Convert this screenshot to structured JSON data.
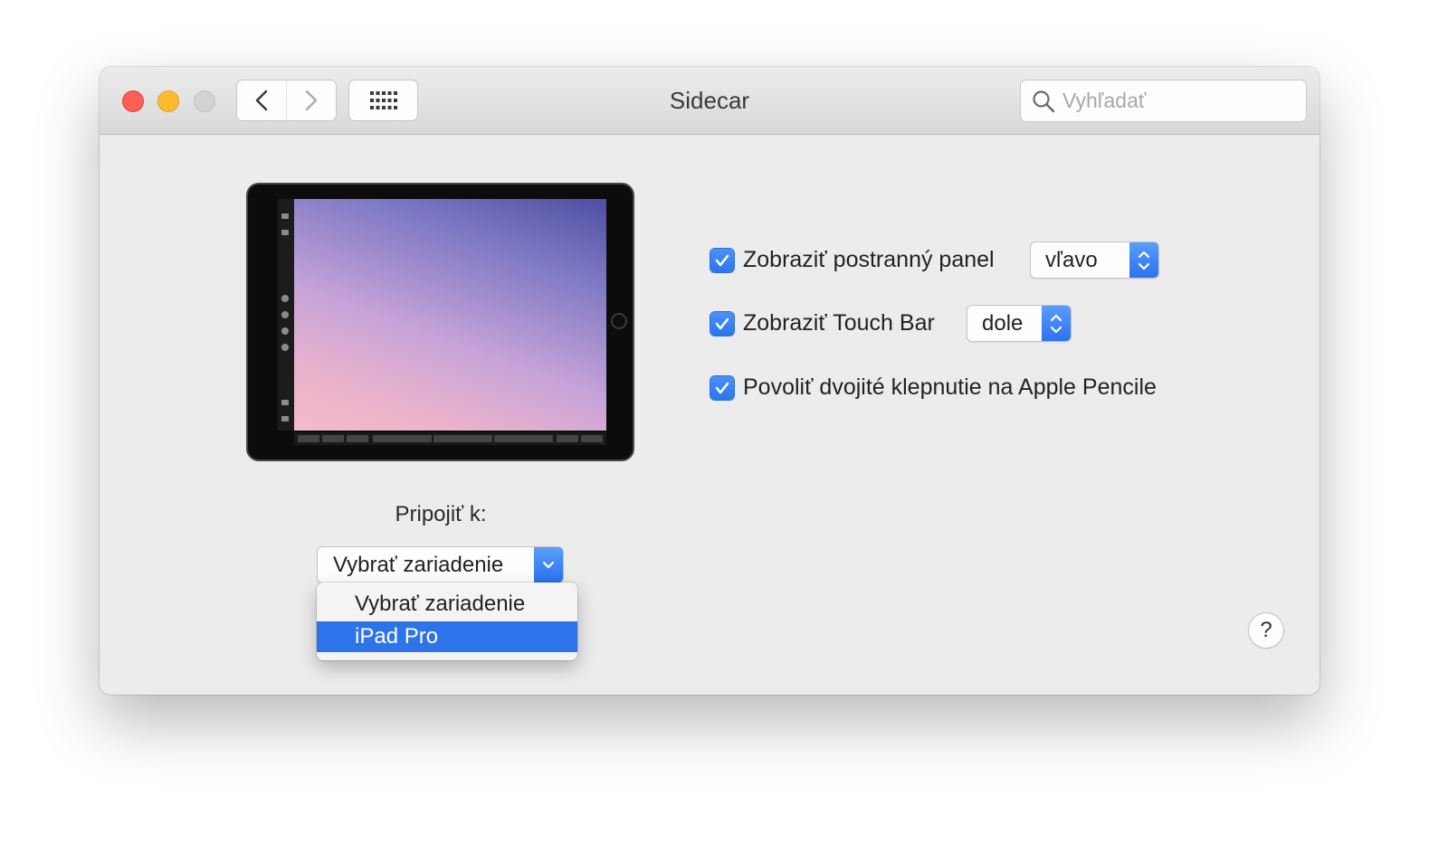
{
  "window": {
    "title": "Sidecar",
    "search_placeholder": "Vyhľadať"
  },
  "preview": {
    "device": "iPad",
    "wallpaper_colors": [
      "#4e4ea2",
      "#c6a3d8",
      "#f3bcc9"
    ]
  },
  "connect": {
    "label": "Pripojiť k:",
    "selected": "Vybrať zariadenie",
    "menu_items": [
      {
        "label": "Vybrať zariadenie",
        "highlighted": false
      },
      {
        "label": "iPad Pro",
        "highlighted": true
      }
    ]
  },
  "options": {
    "sidebar": {
      "label": "Zobraziť postranný panel",
      "checked": true,
      "position": "vľavo"
    },
    "touchbar": {
      "label": "Zobraziť Touch Bar",
      "checked": true,
      "position": "dole"
    },
    "pencil": {
      "label": "Povoliť dvojité klepnutie na Apple Pencile",
      "checked": true
    }
  },
  "help": {
    "label": "?"
  },
  "colors": {
    "accent": "#2d73ea",
    "close": "#fd5f57",
    "minimize": "#febb2e",
    "zoom_disabled": "#d3d3d3"
  }
}
